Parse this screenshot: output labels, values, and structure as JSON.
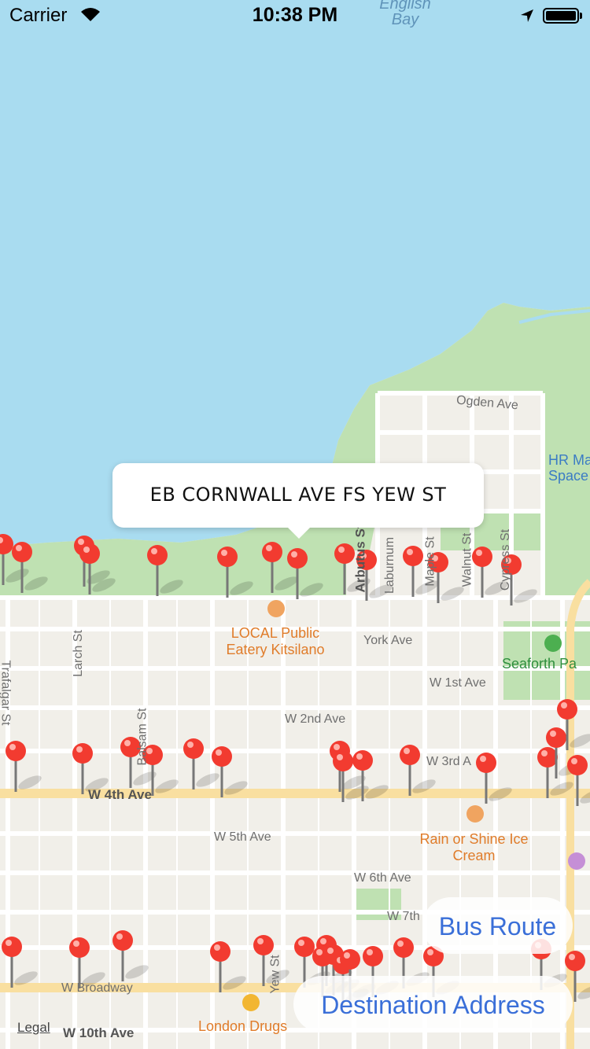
{
  "status_bar": {
    "carrier": "Carrier",
    "time": "10:38 PM"
  },
  "map": {
    "water_label": [
      "English",
      "Bay"
    ],
    "streets": {
      "ogden_ave": "Ogden Ave",
      "york_ave": "York Ave",
      "w_1st_ave": "W 1st Ave",
      "w_2nd_ave": "W 2nd Ave",
      "w_3rd_ave": "W 3rd A",
      "w_4th_ave": "W 4th Ave",
      "w_5th_ave": "W 5th Ave",
      "w_6th_ave": "W 6th Ave",
      "w_7th": "W 7th",
      "w_broadway": "W Broadway",
      "w_10th_ave": "W 10th Ave",
      "trafalgar_st": "Trafalgar St",
      "larch_st": "Larch St",
      "balsam_st": "Balsam St",
      "yew_st": "Yew St",
      "arbutus_st": "Arbutus St",
      "laburnum": "Laburnum",
      "maple_st": "Maple St",
      "walnut_st": "Walnut St",
      "cypress_st": "Cypress St"
    },
    "pois": {
      "local_eatery": "LOCAL Public Eatery Kitsilano",
      "rain_or_shine": "Rain or Shine Ice Cream",
      "london_drugs": "London Drugs",
      "seaforth": "Seaforth Pa",
      "hr_ma": "HR Ma",
      "space": "Space"
    },
    "pin_count": 50
  },
  "callout": {
    "title": "EB CORNWALL AVE FS YEW ST"
  },
  "buttons": {
    "bus_route": "Bus Route",
    "destination_address": "Destination Address"
  },
  "legal": "Legal",
  "colors": {
    "water": "#a9dcf0",
    "land": "#f1efe9",
    "park": "#bfe1b2",
    "road": "#ffffff",
    "major_road": "#f9dfa0",
    "pin": "#f23b30",
    "button_text": "#3a6fd8"
  }
}
